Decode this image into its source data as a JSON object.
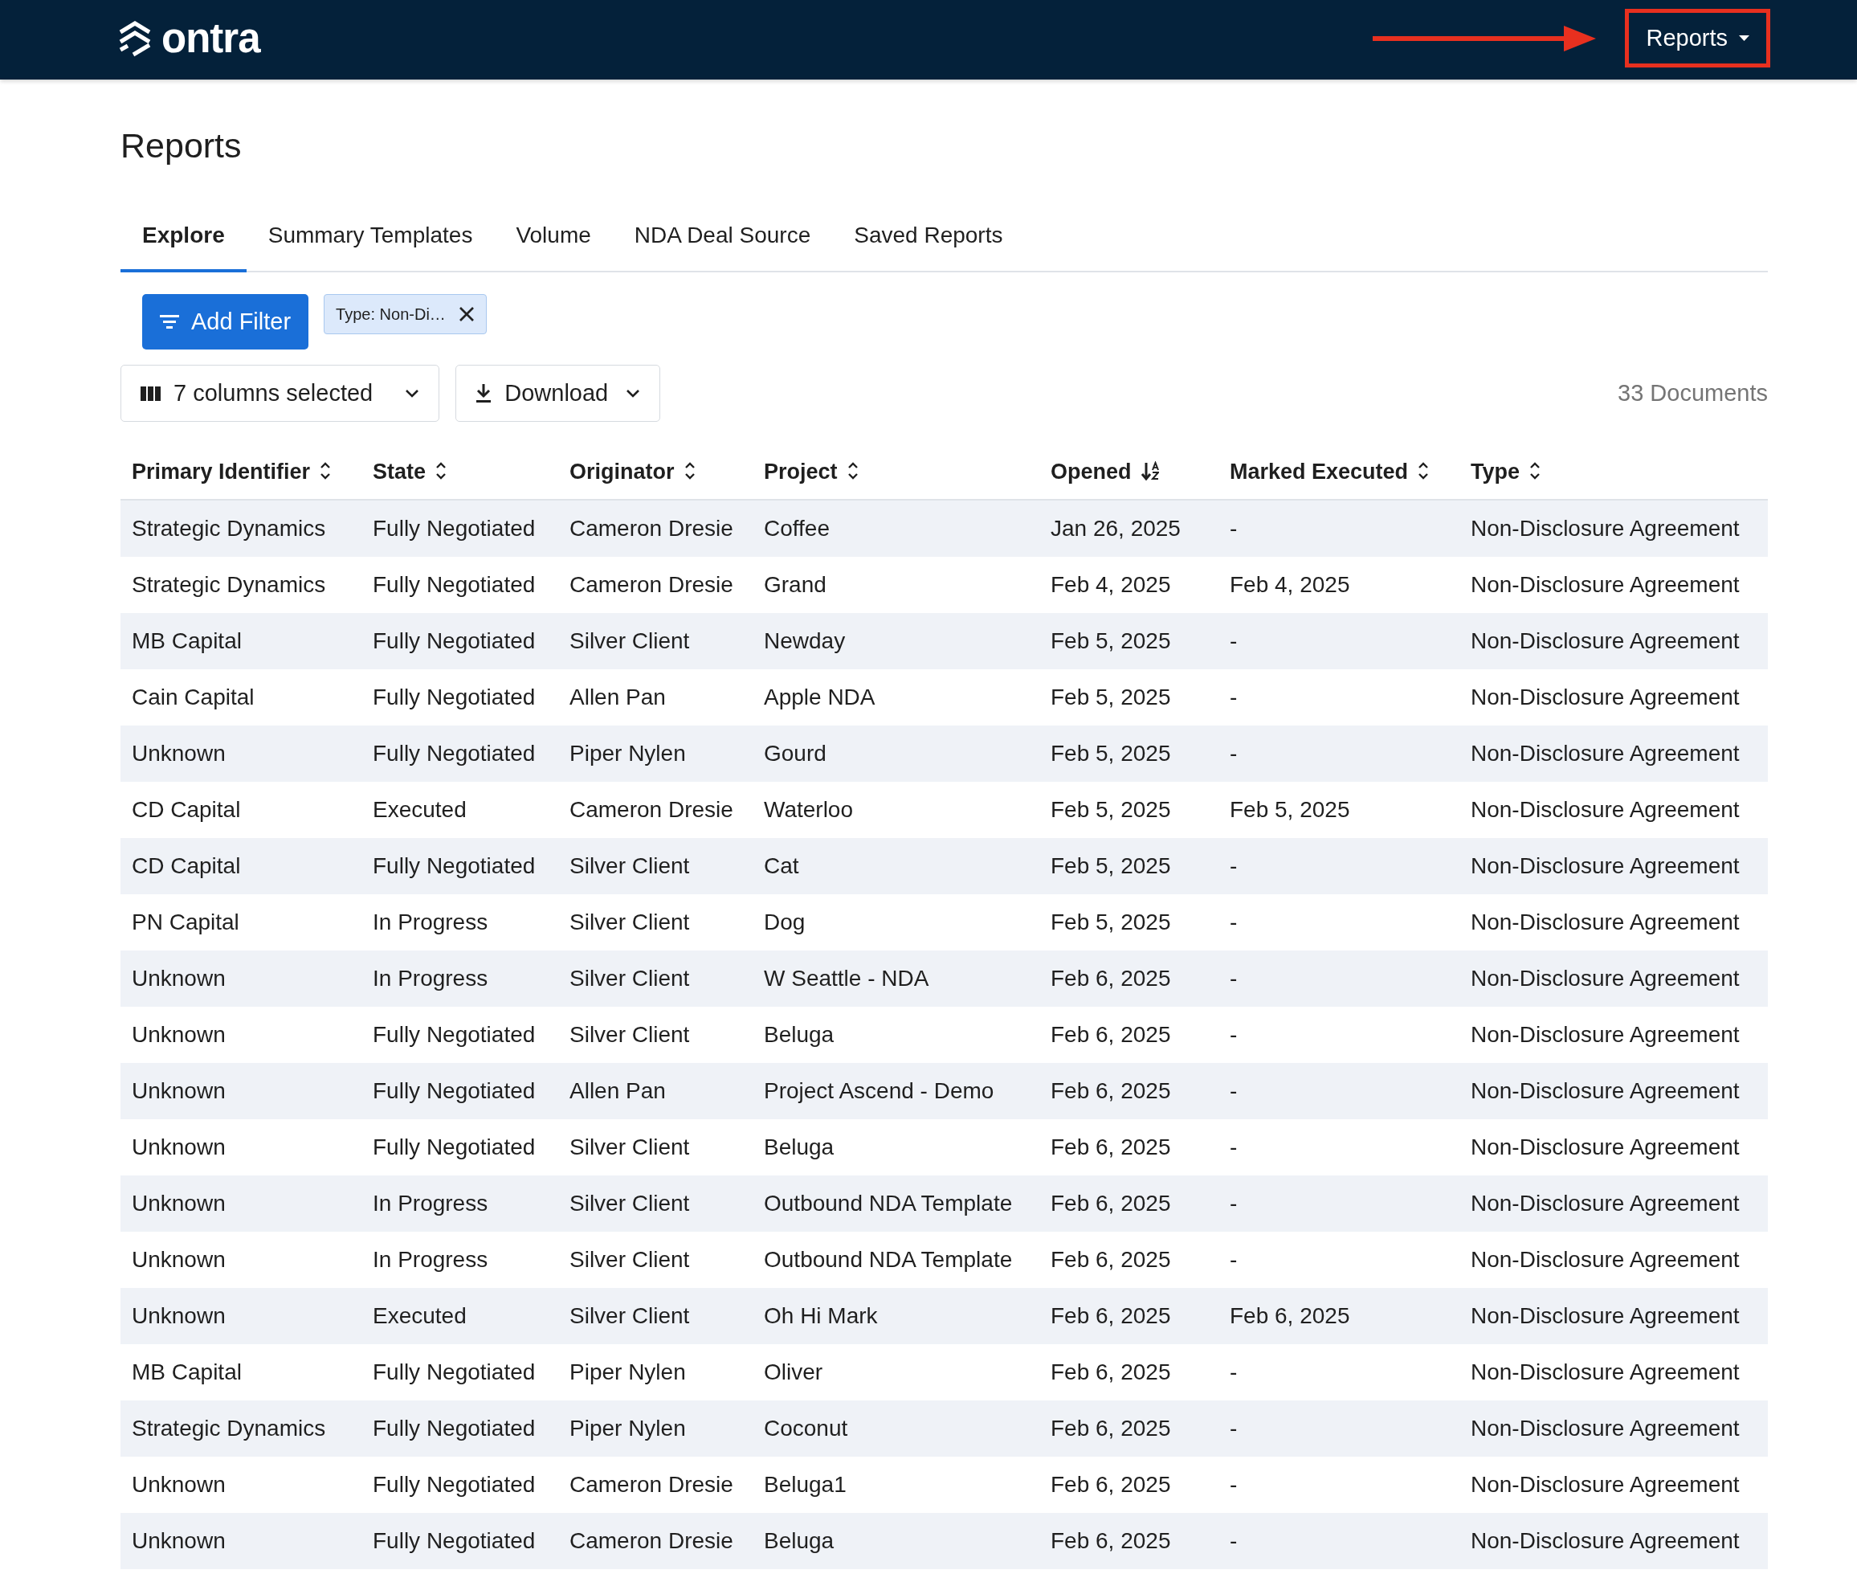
{
  "nav": {
    "brand": "ontra",
    "menu": {
      "label": "Reports",
      "highlighted": true
    }
  },
  "page_title": "Reports",
  "tabs": [
    {
      "label": "Explore",
      "selected": true
    },
    {
      "label": "Summary Templates",
      "selected": false
    },
    {
      "label": "Volume",
      "selected": false
    },
    {
      "label": "NDA Deal Source",
      "selected": false
    },
    {
      "label": "Saved Reports",
      "selected": false
    }
  ],
  "filters": {
    "add_button": "Add Filter",
    "chips": [
      {
        "label": "Type: Non-Di…"
      }
    ]
  },
  "toolbar": {
    "columns_dropdown": "7 columns selected",
    "download_button": "Download",
    "document_count": "33 Documents"
  },
  "table": {
    "columns": [
      {
        "label": "Primary Identifier",
        "sorted": false
      },
      {
        "label": "State",
        "sorted": false
      },
      {
        "label": "Originator",
        "sorted": false
      },
      {
        "label": "Project",
        "sorted": false
      },
      {
        "label": "Opened",
        "sorted": true
      },
      {
        "label": "Marked Executed",
        "sorted": false
      },
      {
        "label": "Type",
        "sorted": false
      }
    ],
    "rows": [
      [
        "Strategic Dynamics",
        "Fully Negotiated",
        "Cameron Dresie",
        "Coffee",
        "Jan 26, 2025",
        "-",
        "Non-Disclosure Agreement"
      ],
      [
        "Strategic Dynamics",
        "Fully Negotiated",
        "Cameron Dresie",
        "Grand",
        "Feb 4, 2025",
        "Feb 4, 2025",
        "Non-Disclosure Agreement"
      ],
      [
        "MB Capital",
        "Fully Negotiated",
        "Silver Client",
        "Newday",
        "Feb 5, 2025",
        "-",
        "Non-Disclosure Agreement"
      ],
      [
        "Cain Capital",
        "Fully Negotiated",
        "Allen Pan",
        "Apple NDA",
        "Feb 5, 2025",
        "-",
        "Non-Disclosure Agreement"
      ],
      [
        "Unknown",
        "Fully Negotiated",
        "Piper Nylen",
        "Gourd",
        "Feb 5, 2025",
        "-",
        "Non-Disclosure Agreement"
      ],
      [
        "CD Capital",
        "Executed",
        "Cameron Dresie",
        "Waterloo",
        "Feb 5, 2025",
        "Feb 5, 2025",
        "Non-Disclosure Agreement"
      ],
      [
        "CD Capital",
        "Fully Negotiated",
        "Silver Client",
        "Cat",
        "Feb 5, 2025",
        "-",
        "Non-Disclosure Agreement"
      ],
      [
        "PN Capital",
        "In Progress",
        "Silver Client",
        "Dog",
        "Feb 5, 2025",
        "-",
        "Non-Disclosure Agreement"
      ],
      [
        "Unknown",
        "In Progress",
        "Silver Client",
        "W Seattle - NDA",
        "Feb 6, 2025",
        "-",
        "Non-Disclosure Agreement"
      ],
      [
        "Unknown",
        "Fully Negotiated",
        "Silver Client",
        "Beluga",
        "Feb 6, 2025",
        "-",
        "Non-Disclosure Agreement"
      ],
      [
        "Unknown",
        "Fully Negotiated",
        "Allen Pan",
        "Project Ascend - Demo",
        "Feb 6, 2025",
        "-",
        "Non-Disclosure Agreement"
      ],
      [
        "Unknown",
        "Fully Negotiated",
        "Silver Client",
        "Beluga",
        "Feb 6, 2025",
        "-",
        "Non-Disclosure Agreement"
      ],
      [
        "Unknown",
        "In Progress",
        "Silver Client",
        "Outbound NDA Template",
        "Feb 6, 2025",
        "-",
        "Non-Disclosure Agreement"
      ],
      [
        "Unknown",
        "In Progress",
        "Silver Client",
        "Outbound NDA Template",
        "Feb 6, 2025",
        "-",
        "Non-Disclosure Agreement"
      ],
      [
        "Unknown",
        "Executed",
        "Silver Client",
        "Oh Hi Mark",
        "Feb 6, 2025",
        "Feb 6, 2025",
        "Non-Disclosure Agreement"
      ],
      [
        "MB Capital",
        "Fully Negotiated",
        "Piper Nylen",
        "Oliver",
        "Feb 6, 2025",
        "-",
        "Non-Disclosure Agreement"
      ],
      [
        "Strategic Dynamics",
        "Fully Negotiated",
        "Piper Nylen",
        "Coconut",
        "Feb 6, 2025",
        "-",
        "Non-Disclosure Agreement"
      ],
      [
        "Unknown",
        "Fully Negotiated",
        "Cameron Dresie",
        "Beluga1",
        "Feb 6, 2025",
        "-",
        "Non-Disclosure Agreement"
      ],
      [
        "Unknown",
        "Fully Negotiated",
        "Cameron Dresie",
        "Beluga",
        "Feb 6, 2025",
        "-",
        "Non-Disclosure Agreement"
      ]
    ]
  }
}
